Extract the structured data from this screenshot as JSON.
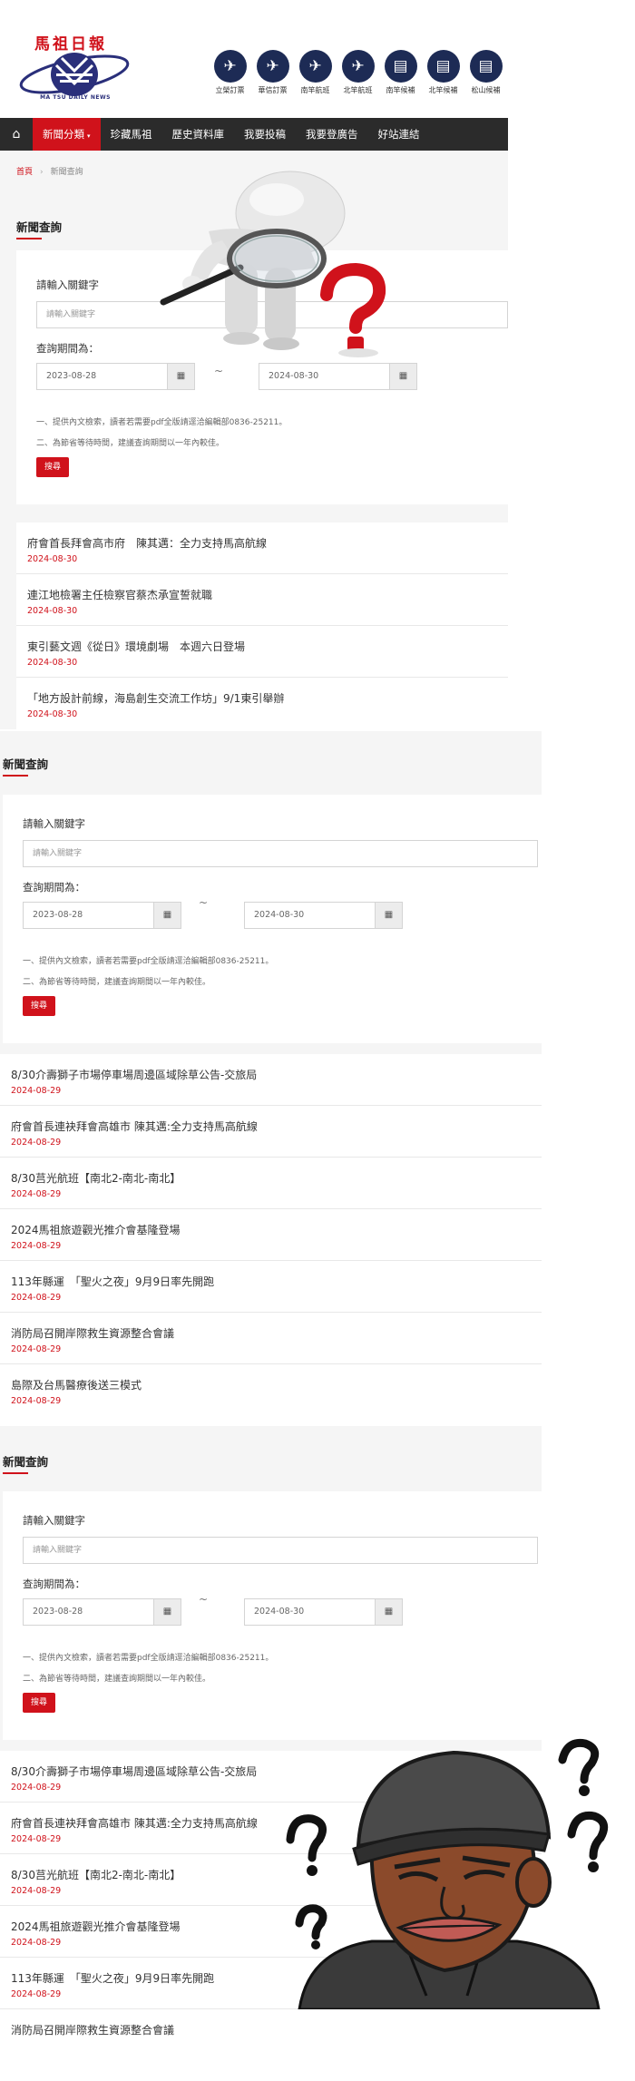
{
  "header": {
    "logo_title": "馬祖日報",
    "logo_sub": "MA TSU DAILY NEWS",
    "quick_links": [
      {
        "label": "立榮訂票",
        "icon": "airplane-icon",
        "glyph": "✈"
      },
      {
        "label": "華信訂票",
        "icon": "airplane-icon",
        "glyph": "✈"
      },
      {
        "label": "南竿航班",
        "icon": "plane-departure-icon",
        "glyph": "✈"
      },
      {
        "label": "北竿航班",
        "icon": "plane-departure-icon",
        "glyph": "✈"
      },
      {
        "label": "南竿候補",
        "icon": "booklet-icon",
        "glyph": "▤"
      },
      {
        "label": "北竿候補",
        "icon": "booklet-icon",
        "glyph": "▤"
      },
      {
        "label": "松山候補",
        "icon": "booklet-icon",
        "glyph": "▤"
      },
      {
        "label": "",
        "icon": "booklet-icon",
        "glyph": "▤"
      }
    ]
  },
  "nav": {
    "home_glyph": "⌂",
    "items": [
      "新聞分類",
      "珍藏馬祖",
      "歷史資料庫",
      "我要投稿",
      "我要登廣告",
      "好站連結"
    ],
    "active_caret": "▾"
  },
  "breadcrumb": {
    "home": "首頁",
    "sep": "›",
    "current": "新聞查詢"
  },
  "search": {
    "title": "新聞查詢",
    "keyword_label": "請輸入關鍵字",
    "keyword_placeholder": "請輸入關鍵字",
    "period_label": "查詢期間為：",
    "date_from": "2023-08-28",
    "date_to": "2024-08-30",
    "tilde": "~",
    "calendar_glyph": "▦",
    "note1": "一、提供內文檢索，讀者若需要pdf全版請逕洽編輯部0836-25211。",
    "note2": "二、為節省等待時間，建議查詢期間以一年內較佳。",
    "submit_label": "搜尋"
  },
  "news_list_1": [
    {
      "title": "府會首長拜會高市府　陳其邁：全力支持馬高航線",
      "date": "2024-08-30"
    },
    {
      "title": "連江地檢署主任檢察官蔡杰承宣誓就職",
      "date": "2024-08-30"
    },
    {
      "title": "東引藝文週《從日》環境劇場　本週六日登場",
      "date": "2024-08-30"
    },
    {
      "title": "「地方設計前線，海島創生交流工作坊」9/1東引舉辦",
      "date": "2024-08-30"
    }
  ],
  "news_list_2": [
    {
      "title": "8/30介壽獅子市場停車場周邊區域除草公告-交旅局",
      "date": "2024-08-29"
    },
    {
      "title": "府會首長連袂拜會高雄市 陳其邁:全力支持馬高航線",
      "date": "2024-08-29"
    },
    {
      "title": "8/30莒光航班【南北2-南北-南北】",
      "date": "2024-08-29"
    },
    {
      "title": "2024馬祖旅遊觀光推介會基隆登場",
      "date": "2024-08-29"
    },
    {
      "title": "113年縣運　「聖火之夜」9月9日率先開跑",
      "date": "2024-08-29"
    },
    {
      "title": "消防局召開岸際救生資源整合會議",
      "date": "2024-08-29"
    },
    {
      "title": "島際及台馬醫療後送三模式",
      "date": "2024-08-29"
    }
  ],
  "news_list_3": [
    {
      "title": "8/30介壽獅子市場停車場周邊區域除草公告-交旅局",
      "date": "2024-08-29"
    },
    {
      "title": "府會首長連袂拜會高雄市 陳其邁:全力支持馬高航線",
      "date": "2024-08-29"
    },
    {
      "title": "8/30莒光航班【南北2-南北-南北】",
      "date": "2024-08-29"
    },
    {
      "title": "2024馬祖旅遊觀光推介會基隆登場",
      "date": "2024-08-29"
    },
    {
      "title": "113年縣運　「聖火之夜」9月9日率先開跑",
      "date": "2024-08-29"
    },
    {
      "title": "消防局召開岸際救生資源整合會議",
      "date": ""
    }
  ],
  "colors": {
    "brand_red": "#d0121b",
    "nav_dark": "#2b2b2b",
    "navy": "#1d2b55"
  },
  "overlays": {
    "magnifier": "question-magnifier-icon",
    "meme": "confused-face-icon"
  }
}
